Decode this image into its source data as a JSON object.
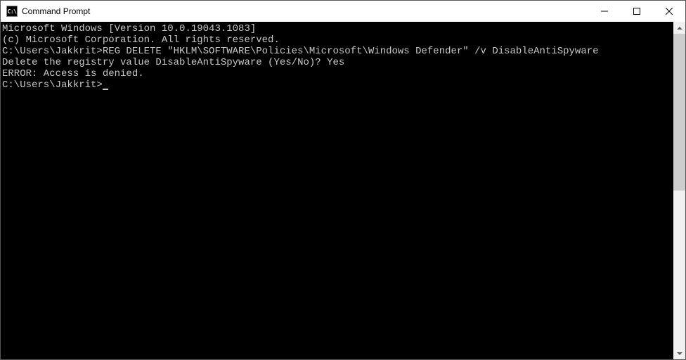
{
  "window": {
    "title": "Command Prompt",
    "icon_label": "C:\\"
  },
  "terminal": {
    "lines": [
      "Microsoft Windows [Version 10.0.19043.1083]",
      "(c) Microsoft Corporation. All rights reserved.",
      "",
      "C:\\Users\\Jakkrit>REG DELETE \"HKLM\\SOFTWARE\\Policies\\Microsoft\\Windows Defender\" /v DisableAntiSpyware",
      "Delete the registry value DisableAntiSpyware (Yes/No)? Yes",
      "ERROR: Access is denied.",
      "",
      "C:\\Users\\Jakkrit>"
    ]
  }
}
